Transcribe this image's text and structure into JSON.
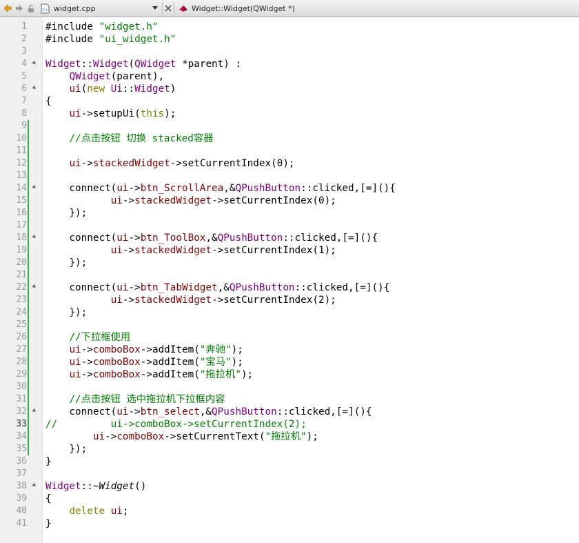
{
  "toolbar": {
    "back_icon": "back-arrow-icon",
    "forward_icon": "forward-arrow-icon",
    "lock_icon": "lock-icon",
    "file_icon": "cpp-file-icon",
    "file_name": "widget.cpp",
    "close_icon": "close-icon",
    "symbol_icon": "function-icon",
    "symbol_name": "Widget::Widget(QWidget *)"
  },
  "editor": {
    "current_line": 33,
    "changed_lines_start": 9,
    "changed_lines_end": 35,
    "lines": [
      {
        "n": "1",
        "t": "#include \"widget.h\""
      },
      {
        "n": "2",
        "t": "#include \"ui_widget.h\""
      },
      {
        "n": "3",
        "t": ""
      },
      {
        "n": "4",
        "t": "Widget::Widget(QWidget *parent) :",
        "fold": true
      },
      {
        "n": "5",
        "t": "    QWidget(parent),"
      },
      {
        "n": "6",
        "t": "    ui(new Ui::Widget)",
        "fold": true
      },
      {
        "n": "7",
        "t": "{"
      },
      {
        "n": "8",
        "t": "    ui->setupUi(this);"
      },
      {
        "n": "9",
        "t": ""
      },
      {
        "n": "10",
        "t": "    //点击按钮 切换 stacked容器"
      },
      {
        "n": "11",
        "t": ""
      },
      {
        "n": "12",
        "t": "    ui->stackedWidget->setCurrentIndex(0);"
      },
      {
        "n": "13",
        "t": ""
      },
      {
        "n": "14",
        "t": "    connect(ui->btn_ScrollArea,&QPushButton::clicked,[=](){",
        "fold": true
      },
      {
        "n": "15",
        "t": "           ui->stackedWidget->setCurrentIndex(0);"
      },
      {
        "n": "16",
        "t": "    });"
      },
      {
        "n": "17",
        "t": ""
      },
      {
        "n": "18",
        "t": "    connect(ui->btn_ToolBox,&QPushButton::clicked,[=](){",
        "fold": true
      },
      {
        "n": "19",
        "t": "           ui->stackedWidget->setCurrentIndex(1);"
      },
      {
        "n": "20",
        "t": "    });"
      },
      {
        "n": "21",
        "t": ""
      },
      {
        "n": "22",
        "t": "    connect(ui->btn_TabWidget,&QPushButton::clicked,[=](){",
        "fold": true
      },
      {
        "n": "23",
        "t": "           ui->stackedWidget->setCurrentIndex(2);"
      },
      {
        "n": "24",
        "t": "    });"
      },
      {
        "n": "25",
        "t": ""
      },
      {
        "n": "26",
        "t": "    //下拉框使用"
      },
      {
        "n": "27",
        "t": "    ui->comboBox->addItem(\"奔驰\");"
      },
      {
        "n": "28",
        "t": "    ui->comboBox->addItem(\"宝马\");"
      },
      {
        "n": "29",
        "t": "    ui->comboBox->addItem(\"拖拉机\");"
      },
      {
        "n": "30",
        "t": ""
      },
      {
        "n": "31",
        "t": "    //点击按钮 选中拖拉机下拉框内容"
      },
      {
        "n": "32",
        "t": "    connect(ui->btn_select,&QPushButton::clicked,[=](){",
        "fold": true
      },
      {
        "n": "33",
        "t": "//         ui->comboBox->setCurrentIndex(2);"
      },
      {
        "n": "34",
        "t": "        ui->comboBox->setCurrentText(\"拖拉机\");"
      },
      {
        "n": "35",
        "t": "    });"
      },
      {
        "n": "36",
        "t": "}"
      },
      {
        "n": "37",
        "t": ""
      },
      {
        "n": "38",
        "t": "Widget::~Widget()",
        "fold": true
      },
      {
        "n": "39",
        "t": "{"
      },
      {
        "n": "40",
        "t": "    delete ui;"
      },
      {
        "n": "41",
        "t": "}"
      }
    ]
  }
}
